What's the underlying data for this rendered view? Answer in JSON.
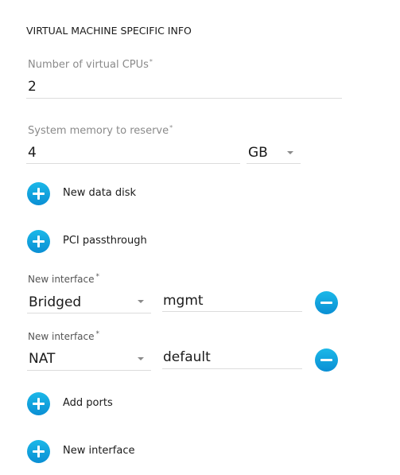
{
  "section": {
    "title": "VIRTUAL MACHINE SPECIFIC INFO"
  },
  "cpus": {
    "label": "Number of virtual CPUs",
    "required": "*",
    "value": "2"
  },
  "memory": {
    "label": "System memory to reserve",
    "required": "*",
    "value": "4",
    "unit": "GB"
  },
  "actions": {
    "new_data_disk": "New data disk",
    "pci_passthrough": "PCI passthrough",
    "add_ports": "Add ports",
    "new_interface": "New interface"
  },
  "interfaces": [
    {
      "label": "New interface",
      "required": "*",
      "type": "Bridged",
      "network": "mgmt"
    },
    {
      "label": "New interface",
      "required": "*",
      "type": "NAT",
      "network": "default"
    }
  ],
  "colors": {
    "accent": "#0a9fdc"
  }
}
